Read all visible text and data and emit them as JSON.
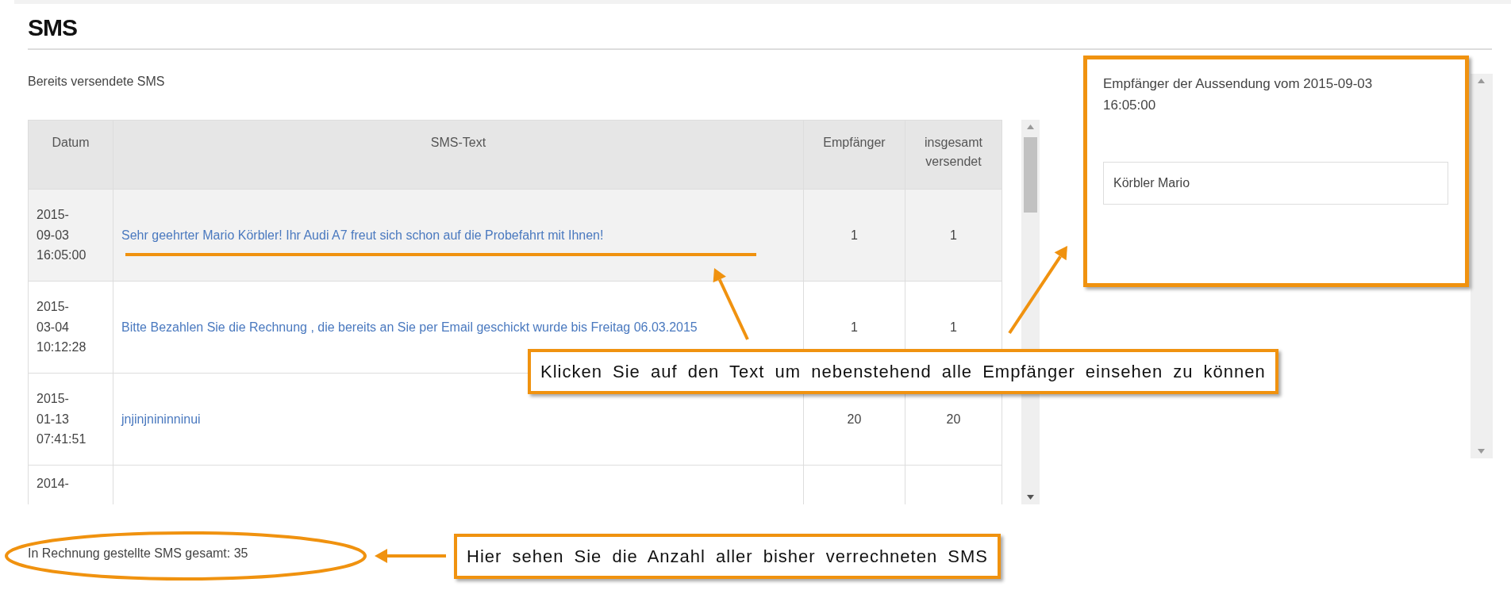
{
  "page_title": "SMS",
  "section_label": "Bereits versendete SMS",
  "table": {
    "columns": [
      "Datum",
      "SMS-Text",
      "Empfänger",
      "insgesamt versendet"
    ],
    "rows": [
      {
        "date": [
          "2015-",
          "09-03",
          "16:05:00"
        ],
        "text": "Sehr geehrter Mario Körbler! Ihr Audi A7 freut sich schon auf die Probefahrt mit Ihnen!",
        "recipients": "1",
        "total_sent": "1",
        "selected": true
      },
      {
        "date": [
          "2015-",
          "03-04",
          "10:12:28"
        ],
        "text": "Bitte Bezahlen Sie die Rechnung , die bereits an Sie per Email geschickt wurde bis Freitag 06.03.2015",
        "recipients": "1",
        "total_sent": "1",
        "selected": false
      },
      {
        "date": [
          "2015-",
          "01-13",
          "07:41:51"
        ],
        "text": "jnjinjnininninui",
        "recipients": "20",
        "total_sent": "20",
        "selected": false
      },
      {
        "date": [
          "2014-"
        ],
        "selected": false
      }
    ]
  },
  "recipients_panel": {
    "title": "Empfänger der Aussendung vom 2015-09-03 16:05:00",
    "recipients": [
      "Körbler Mario"
    ]
  },
  "billed_total": "In Rechnung gestellte SMS gesamt: 35",
  "annotations": [
    {
      "kind": "callout",
      "text": "Klicken Sie auf den Text um nebenstehend alle Empfänger einsehen zu können"
    },
    {
      "kind": "callout",
      "text": "Hier sehen Sie die Anzahl aller bisher verrechneten SMS"
    }
  ]
}
